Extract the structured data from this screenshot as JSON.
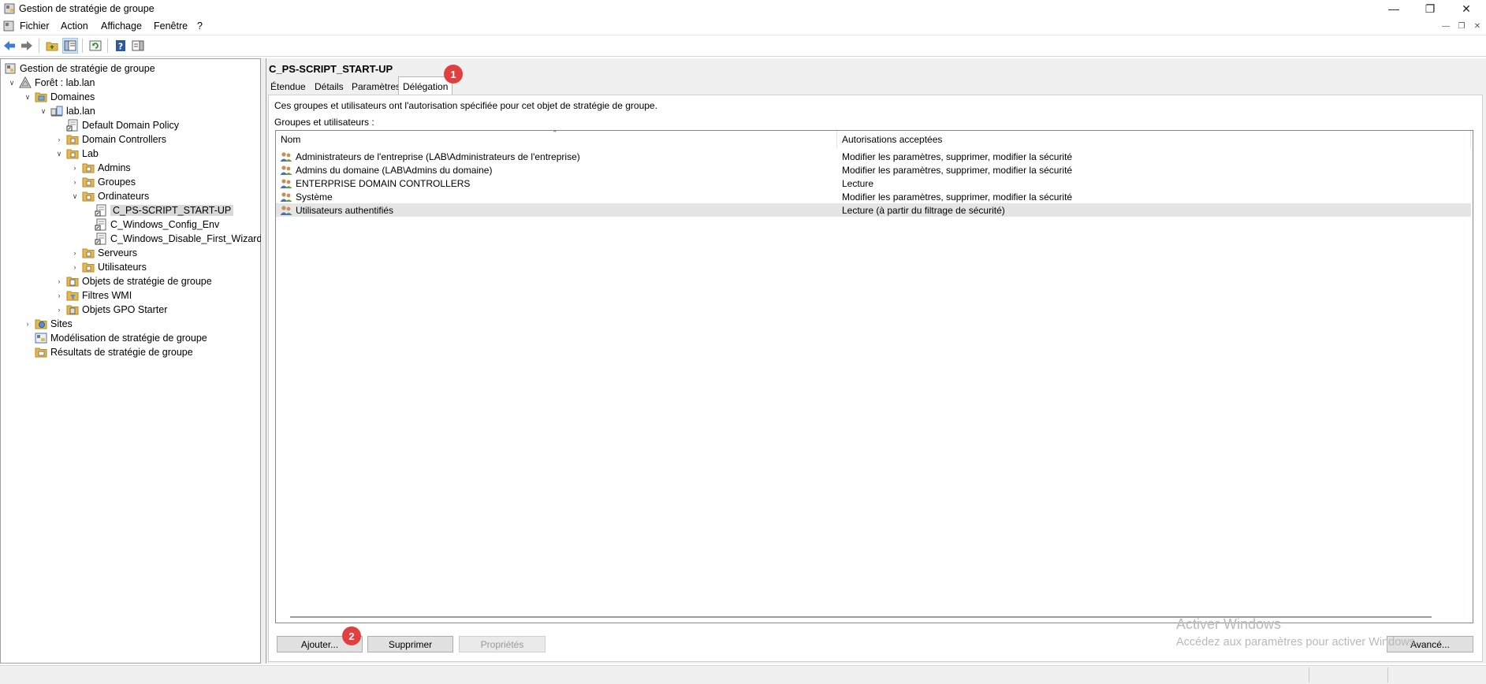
{
  "window": {
    "title": "Gestion de stratégie de groupe"
  },
  "menu": {
    "items": [
      "Fichier",
      "Action",
      "Affichage",
      "Fenêtre",
      "?"
    ]
  },
  "tree": {
    "root": "Gestion de stratégie de groupe",
    "forest": "Forêt : lab.lan",
    "domains": "Domaines",
    "domain": "lab.lan",
    "default_policy": "Default Domain Policy",
    "domain_controllers": "Domain Controllers",
    "lab": "Lab",
    "admins": "Admins",
    "groupes": "Groupes",
    "ordinateurs": "Ordinateurs",
    "gpo_selected": "C_PS-SCRIPT_START-UP",
    "gpo_config_env": "C_Windows_Config_Env",
    "gpo_disable_wizard": "C_Windows_Disable_First_Wizard",
    "serveurs": "Serveurs",
    "utilisateurs": "Utilisateurs",
    "gpo_objects": "Objets de stratégie de groupe",
    "wmi_filters": "Filtres WMI",
    "starter_gpos": "Objets GPO Starter",
    "sites": "Sites",
    "modeling": "Modélisation de stratégie de groupe",
    "results": "Résultats de stratégie de groupe"
  },
  "details": {
    "title": "C_PS-SCRIPT_START-UP",
    "tabs": [
      "Étendue",
      "Détails",
      "Paramètres",
      "Délégation"
    ],
    "active_tab": "Délégation",
    "description": "Ces groupes et utilisateurs ont l'autorisation spécifiée pour cet objet de stratégie de groupe.",
    "groups_label": "Groupes et utilisateurs :",
    "columns": {
      "name": "Nom",
      "permissions": "Autorisations acceptées"
    },
    "rows": [
      {
        "name": "Administrateurs de l'entreprise (LAB\\Administrateurs de l'entreprise)",
        "perm": "Modifier les paramètres, supprimer, modifier la sécurité"
      },
      {
        "name": "Admins du domaine (LAB\\Admins du domaine)",
        "perm": "Modifier les paramètres, supprimer, modifier la sécurité"
      },
      {
        "name": "ENTERPRISE DOMAIN CONTROLLERS",
        "perm": "Lecture"
      },
      {
        "name": "Système",
        "perm": "Modifier les paramètres, supprimer, modifier la sécurité"
      },
      {
        "name": "Utilisateurs authentifiés",
        "perm": "Lecture (à partir du filtrage de sécurité)"
      }
    ],
    "buttons": {
      "add": "Ajouter...",
      "remove": "Supprimer",
      "properties": "Propriétés",
      "advanced": "Avancé..."
    }
  },
  "annotations": {
    "badge1": "1",
    "badge2": "2"
  },
  "watermark": {
    "line1": "Activer Windows",
    "line2": "Accédez aux paramètres pour activer Windows."
  },
  "colors": {
    "badge": "#e04040",
    "folder": "#e8b84a",
    "selection": "#d9d9d9"
  }
}
